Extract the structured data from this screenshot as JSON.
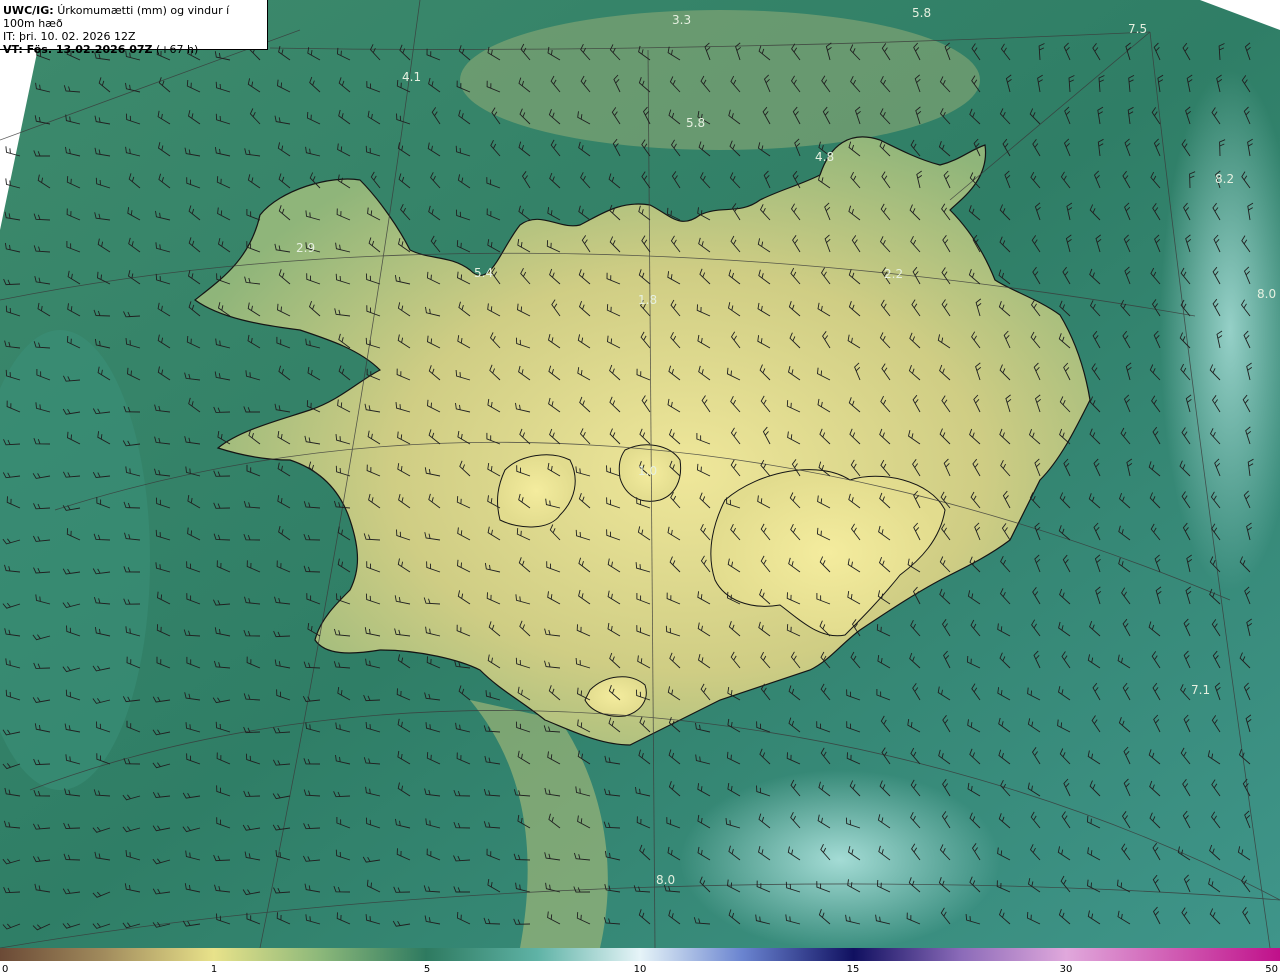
{
  "header": {
    "model": "UWC/IG:",
    "title": "Úrkomumætti (mm) og vindur í 100m hæð",
    "issue_time": "IT: þri. 10. 02. 2026 12Z",
    "valid_label": "VT: Fös. 13.02.2026 07Z",
    "valid_offset": "(+67 h)"
  },
  "map_labels": [
    "3.3",
    "5.8",
    "7.5",
    "4.1",
    "5.8",
    "4.8",
    "8.2",
    "2.9",
    "5.4",
    "1.8",
    "2.2",
    "8.0",
    "1.0",
    "7.1",
    "8.0"
  ],
  "colorbar": {
    "ticks": [
      "0",
      "1",
      "5",
      "10",
      "15",
      "30",
      "50"
    ],
    "colors": [
      "#6b4a36",
      "#a08a5c",
      "#e8e28a",
      "#2e7a60",
      "#9fe0d8",
      "#e6f4f8",
      "#1b2f9a",
      "#101060",
      "#d078c8",
      "#c0108a"
    ]
  },
  "colors": {
    "sea": "#2a7a63",
    "land": "#c8c77a",
    "coast": "#1a1a1a"
  }
}
